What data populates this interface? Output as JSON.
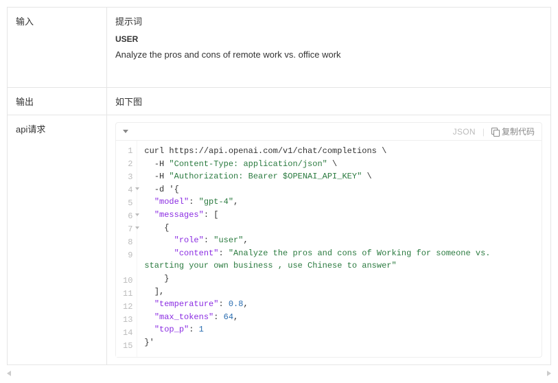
{
  "rows": {
    "input_label": "输入",
    "output_label": "输出",
    "api_label": "api请求"
  },
  "input": {
    "heading": "提示词",
    "role_label": "USER",
    "prompt": "Analyze the pros and cons of remote work vs. office work"
  },
  "output": {
    "text": "如下图"
  },
  "code_toolbar": {
    "lang": "JSON",
    "copy_label": "复制代码"
  },
  "code": {
    "lines": [
      {
        "n": 1,
        "fold": false,
        "segs": [
          [
            "curl https://api.openai.com/v1/chat/completions \\",
            "plain"
          ]
        ]
      },
      {
        "n": 2,
        "fold": false,
        "segs": [
          [
            "  -H ",
            "plain"
          ],
          [
            "\"Content-Type: application/json\"",
            "str"
          ],
          [
            " \\",
            "plain"
          ]
        ]
      },
      {
        "n": 3,
        "fold": false,
        "segs": [
          [
            "  -H ",
            "plain"
          ],
          [
            "\"Authorization: Bearer $OPENAI_API_KEY\"",
            "str"
          ],
          [
            " \\",
            "plain"
          ]
        ]
      },
      {
        "n": 4,
        "fold": true,
        "segs": [
          [
            "  -d '{",
            "plain"
          ]
        ]
      },
      {
        "n": 5,
        "fold": false,
        "segs": [
          [
            "  ",
            "plain"
          ],
          [
            "\"model\"",
            "key"
          ],
          [
            ": ",
            "plain"
          ],
          [
            "\"gpt-4\"",
            "str"
          ],
          [
            ",",
            "plain"
          ]
        ]
      },
      {
        "n": 6,
        "fold": true,
        "segs": [
          [
            "  ",
            "plain"
          ],
          [
            "\"messages\"",
            "key"
          ],
          [
            ": [",
            "plain"
          ]
        ]
      },
      {
        "n": 7,
        "fold": true,
        "segs": [
          [
            "    {",
            "plain"
          ]
        ]
      },
      {
        "n": 8,
        "fold": false,
        "segs": [
          [
            "      ",
            "plain"
          ],
          [
            "\"role\"",
            "key"
          ],
          [
            ": ",
            "plain"
          ],
          [
            "\"user\"",
            "str"
          ],
          [
            ",",
            "plain"
          ]
        ]
      },
      {
        "n": 9,
        "fold": false,
        "segs": [
          [
            "      ",
            "plain"
          ],
          [
            "\"content\"",
            "key"
          ],
          [
            ": ",
            "plain"
          ],
          [
            "\"Analyze the pros and cons of Working for someone vs. starting your own business , use Chinese to answer\"",
            "str"
          ]
        ]
      },
      {
        "n": 10,
        "fold": false,
        "segs": [
          [
            "    }",
            "plain"
          ]
        ]
      },
      {
        "n": 11,
        "fold": false,
        "segs": [
          [
            "  ],",
            "plain"
          ]
        ]
      },
      {
        "n": 12,
        "fold": false,
        "segs": [
          [
            "  ",
            "plain"
          ],
          [
            "\"temperature\"",
            "key"
          ],
          [
            ": ",
            "plain"
          ],
          [
            "0.8",
            "num"
          ],
          [
            ",",
            "plain"
          ]
        ]
      },
      {
        "n": 13,
        "fold": false,
        "segs": [
          [
            "  ",
            "plain"
          ],
          [
            "\"max_tokens\"",
            "key"
          ],
          [
            ": ",
            "plain"
          ],
          [
            "64",
            "num"
          ],
          [
            ",",
            "plain"
          ]
        ]
      },
      {
        "n": 14,
        "fold": false,
        "segs": [
          [
            "  ",
            "plain"
          ],
          [
            "\"top_p\"",
            "key"
          ],
          [
            ": ",
            "plain"
          ],
          [
            "1",
            "num"
          ]
        ]
      },
      {
        "n": 15,
        "fold": false,
        "segs": [
          [
            "}'",
            "plain"
          ]
        ]
      }
    ]
  }
}
